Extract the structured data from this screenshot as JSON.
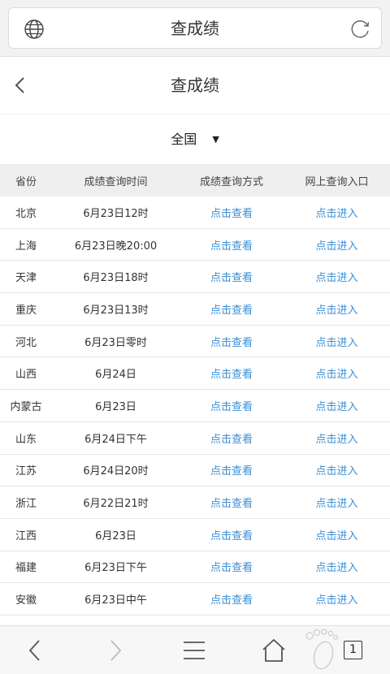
{
  "browser": {
    "url_title": "查成绩",
    "tab_count": "1"
  },
  "page": {
    "title": "查成绩",
    "region": "全国"
  },
  "table": {
    "headers": [
      "省份",
      "成绩查询时间",
      "成绩查询方式",
      "网上查询入口"
    ],
    "rows": [
      [
        "北京",
        "6月23日12时",
        "点击查看",
        "点击进入"
      ],
      [
        "上海",
        "6月23日晚20:00",
        "点击查看",
        "点击进入"
      ],
      [
        "天津",
        "6月23日18时",
        "点击查看",
        "点击进入"
      ],
      [
        "重庆",
        "6月23日13时",
        "点击查看",
        "点击进入"
      ],
      [
        "河北",
        "6月23日零时",
        "点击查看",
        "点击进入"
      ],
      [
        "山西",
        "6月24日",
        "点击查看",
        "点击进入"
      ],
      [
        "内蒙古",
        "6月23日",
        "点击查看",
        "点击进入"
      ],
      [
        "山东",
        "6月24日下午",
        "点击查看",
        "点击进入"
      ],
      [
        "江苏",
        "6月24日20时",
        "点击查看",
        "点击进入"
      ],
      [
        "浙江",
        "6月22日21时",
        "点击查看",
        "点击进入"
      ],
      [
        "江西",
        "6月23日",
        "点击查看",
        "点击进入"
      ],
      [
        "福建",
        "6月23日下午",
        "点击查看",
        "点击进入"
      ],
      [
        "安徽",
        "6月23日中午",
        "点击查看",
        "点击进入"
      ]
    ]
  },
  "toolbar": {
    "icons": [
      "chevron-left-icon",
      "chevron-right-icon",
      "menu-icon",
      "home-icon",
      "footprint-icon",
      "tabs-icon"
    ]
  },
  "colors": {
    "link": "#3a8fd6",
    "header_bg": "#efefef"
  }
}
